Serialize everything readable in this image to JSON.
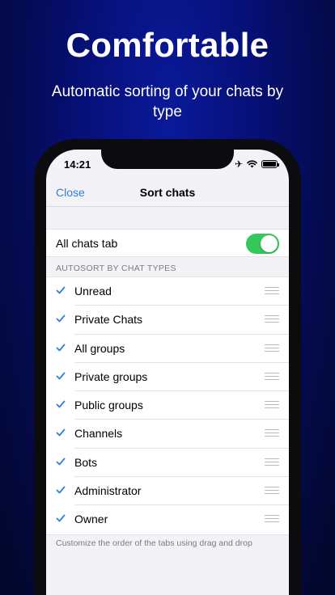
{
  "hero": {
    "title": "Comfortable",
    "subtitle": "Automatic sorting of your chats by type"
  },
  "status_bar": {
    "time": "14:21",
    "icons": [
      "airplane-icon",
      "wifi-icon",
      "battery-icon"
    ]
  },
  "navbar": {
    "close_label": "Close",
    "title": "Sort chats"
  },
  "toggle": {
    "label": "All chats tab",
    "enabled": true
  },
  "section": {
    "header": "AUTOSORT BY CHAT TYPES",
    "items": [
      {
        "label": "Unread",
        "checked": true
      },
      {
        "label": "Private Chats",
        "checked": true
      },
      {
        "label": "All groups",
        "checked": true
      },
      {
        "label": "Private groups",
        "checked": true
      },
      {
        "label": "Public groups",
        "checked": true
      },
      {
        "label": "Channels",
        "checked": true
      },
      {
        "label": "Bots",
        "checked": true
      },
      {
        "label": "Administrator",
        "checked": true
      },
      {
        "label": "Owner",
        "checked": true
      }
    ],
    "footer": "Customize the order of the tabs using drag and drop"
  },
  "colors": {
    "accent": "#2f7fd8",
    "switch_on": "#34c759",
    "background_top": "#0a1a9a",
    "background_bottom": "#020628"
  }
}
